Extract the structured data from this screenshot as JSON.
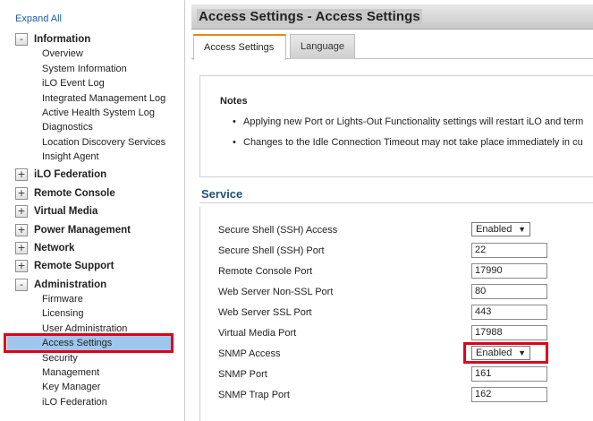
{
  "sidebar": {
    "expand_all": "Expand All",
    "sections": [
      {
        "toggle": "-",
        "label": "Information",
        "items": [
          "Overview",
          "System Information",
          "iLO Event Log",
          "Integrated Management Log",
          "Active Health System Log",
          "Diagnostics",
          "Location Discovery Services",
          "Insight Agent"
        ]
      },
      {
        "toggle": "+",
        "label": "iLO Federation"
      },
      {
        "toggle": "+",
        "label": "Remote Console"
      },
      {
        "toggle": "+",
        "label": "Virtual Media"
      },
      {
        "toggle": "+",
        "label": "Power Management"
      },
      {
        "toggle": "+",
        "label": "Network"
      },
      {
        "toggle": "+",
        "label": "Remote Support"
      },
      {
        "toggle": "-",
        "label": "Administration",
        "items": [
          "Firmware",
          "Licensing",
          "User Administration",
          "Access Settings",
          "Security",
          "Management",
          "Key Manager",
          "iLO Federation"
        ],
        "active_item": "Access Settings"
      }
    ]
  },
  "header": {
    "title": "Access Settings - Access Settings"
  },
  "tabs": [
    {
      "label": "Access Settings",
      "selected": true
    },
    {
      "label": "Language",
      "selected": false
    }
  ],
  "notes": {
    "title": "Notes",
    "bullet": "•",
    "items": [
      "Applying new Port or Lights-Out Functionality settings will restart iLO and term",
      "Changes to the Idle Connection Timeout may not take place immediately in cu"
    ]
  },
  "service": {
    "title": "Service",
    "rows": [
      {
        "label": "Secure Shell (SSH) Access",
        "type": "select",
        "value": "Enabled"
      },
      {
        "label": "Secure Shell (SSH) Port",
        "type": "input",
        "value": "22"
      },
      {
        "label": "Remote Console Port",
        "type": "input",
        "value": "17990"
      },
      {
        "label": "Web Server Non-SSL Port",
        "type": "input",
        "value": "80"
      },
      {
        "label": "Web Server SSL Port",
        "type": "input",
        "value": "443"
      },
      {
        "label": "Virtual Media Port",
        "type": "input",
        "value": "17988"
      },
      {
        "label": "SNMP Access",
        "type": "select",
        "value": "Enabled"
      },
      {
        "label": "SNMP Port",
        "type": "input",
        "value": "161"
      },
      {
        "label": "SNMP Trap Port",
        "type": "input",
        "value": "162"
      }
    ]
  },
  "icons": {
    "dropdown": "▼"
  },
  "colors": {
    "highlight_border": "#e1001a",
    "active_item_bg": "#9fc6ec",
    "tab_accent": "#e48a16",
    "link": "#1f5ea8"
  }
}
